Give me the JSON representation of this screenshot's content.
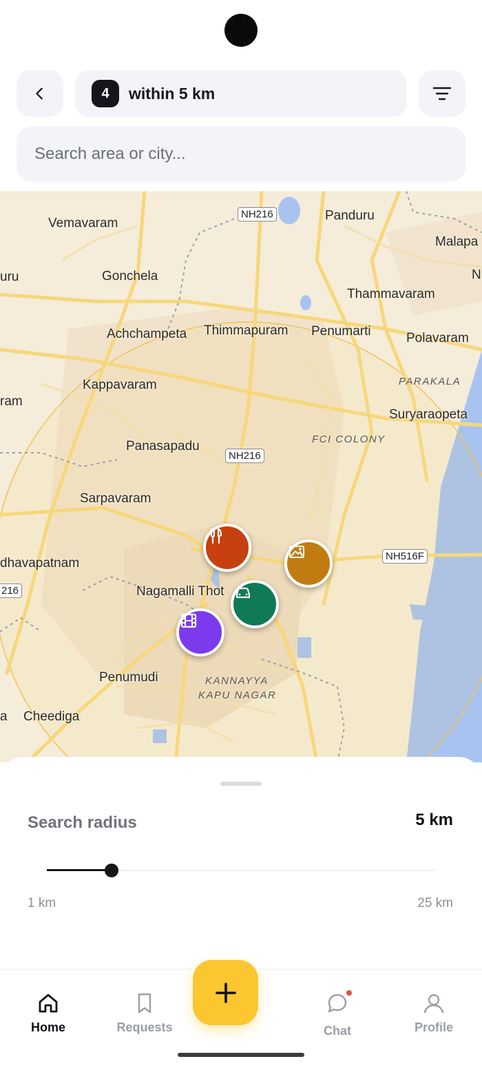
{
  "header": {
    "count": "4",
    "count_text": "within 5 km"
  },
  "search": {
    "placeholder": "Search area or city..."
  },
  "map": {
    "places": [
      {
        "name": "Vemavaram"
      },
      {
        "name": "Panduru"
      },
      {
        "name": "Malapa"
      },
      {
        "name": "uru"
      },
      {
        "name": "Gonchela"
      },
      {
        "name": "N"
      },
      {
        "name": "Thammavaram"
      },
      {
        "name": "Achchampeta"
      },
      {
        "name": "Thimmapuram"
      },
      {
        "name": "Penumarti"
      },
      {
        "name": "Polavaram"
      },
      {
        "name": "Kappavaram"
      },
      {
        "name": "ram"
      },
      {
        "name": "Suryaraopeta"
      },
      {
        "name": "Panasapadu"
      },
      {
        "name": "Sarpavaram"
      },
      {
        "name": "dhavapatnam"
      },
      {
        "name": "Nagamalli Thot"
      },
      {
        "name": "Penumudi"
      },
      {
        "name": "a"
      },
      {
        "name": "Cheediga"
      }
    ],
    "areas": [
      {
        "name": "PARAKALA"
      },
      {
        "name": "FCI COLONY"
      },
      {
        "name": "KANNAYYA"
      },
      {
        "name": "KAPU NAGAR"
      }
    ],
    "roads": [
      {
        "name": "NH216"
      },
      {
        "name": "NH216"
      },
      {
        "name": "NH516F"
      },
      {
        "name": "216"
      }
    ],
    "markers": [
      {
        "name": "restaurant-marker",
        "icon": "fork-knife-icon",
        "color": "#c7400f"
      },
      {
        "name": "scenic-marker",
        "icon": "landscape-icon",
        "color": "#c07c10"
      },
      {
        "name": "car-marker",
        "icon": "car-icon",
        "color": "#0f7a55"
      },
      {
        "name": "cinema-marker",
        "icon": "film-icon",
        "color": "#7c3aed"
      }
    ]
  },
  "sheet": {
    "label": "Search radius",
    "value": "5 km",
    "min_label": "1 km",
    "max_label": "25 km",
    "slider_min": 1,
    "slider_max": 25,
    "slider_value": 5
  },
  "nav": {
    "items": [
      {
        "label": "Home",
        "icon": "home-icon",
        "active": true
      },
      {
        "label": "Requests",
        "icon": "bookmark-icon"
      },
      {
        "label": "Chat",
        "icon": "chat-icon"
      },
      {
        "label": "Profile",
        "icon": "profile-icon"
      }
    ],
    "fab_icon": "plus-icon"
  },
  "colors": {
    "accent": "#fbc62f",
    "map_bg": "#f5ecd9",
    "water": "#a8c3f0"
  }
}
